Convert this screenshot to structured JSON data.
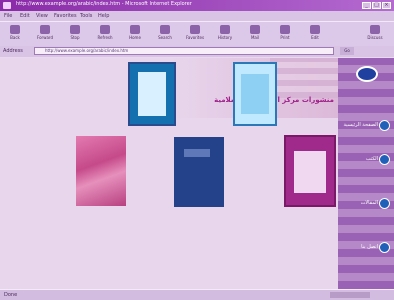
{
  "window": {
    "title": "http://www.example.org/arabic/index.htm - Microsoft Internet Explorer",
    "minimize": "_",
    "maximize": "□",
    "close": "×"
  },
  "menu": [
    "File",
    "Edit",
    "View",
    "Favorites",
    "Tools",
    "Help"
  ],
  "toolbar": {
    "buttons": [
      "Back",
      "Forward",
      "Stop",
      "Refresh",
      "Home",
      "Search",
      "Favorites",
      "History",
      "Mail",
      "Print",
      "Edit",
      "Discuss"
    ]
  },
  "address": {
    "label": "Address",
    "value": "http://www.example.org/arabic/index.htm",
    "go": "Go"
  },
  "page": {
    "heading": "منشورات مركز الدراسات الإسلامية"
  },
  "sidebar": {
    "items": [
      "الصفحة الرئيسية",
      "الكتب",
      "المقالات",
      "اتصل بنا"
    ]
  },
  "status": {
    "text": "Done"
  },
  "colors": {
    "title_bar": "#8a2aa8",
    "heading": "#a0208a",
    "sidebar": "#9a62b4"
  }
}
